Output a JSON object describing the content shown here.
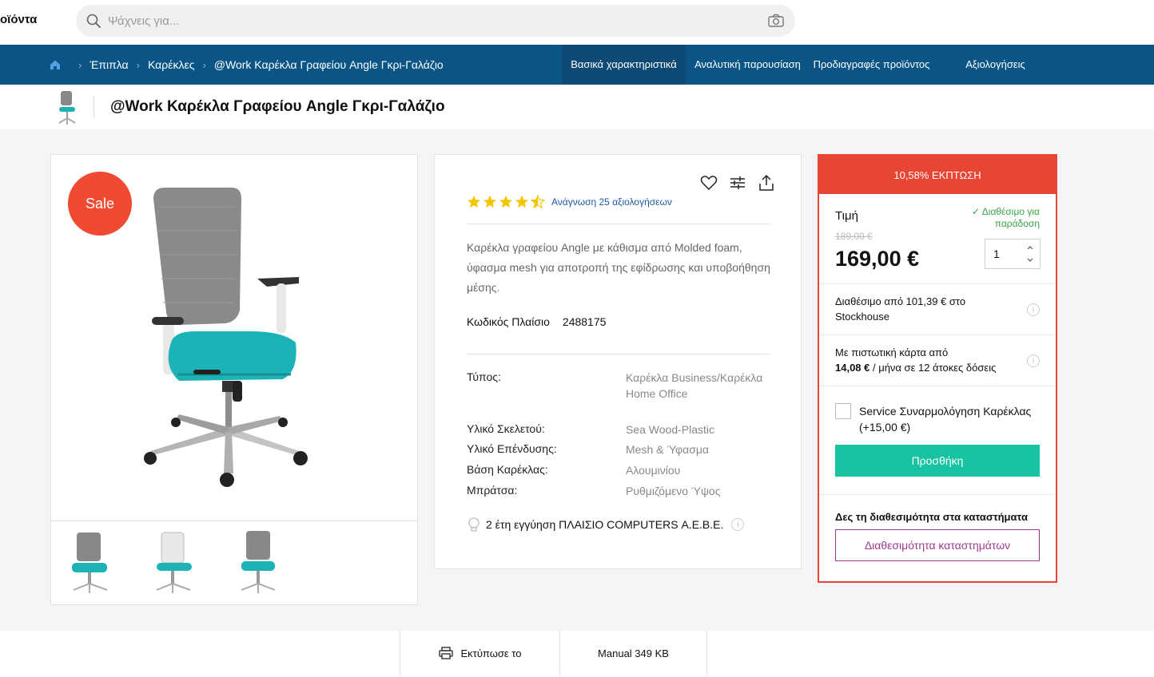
{
  "header": {
    "brand_fragment": "οϊόντα",
    "search_placeholder": "Ψάχνεις για...",
    "search_icon": "search-icon",
    "camera_icon": "camera-icon"
  },
  "breadcrumb": {
    "home_icon": "home-icon",
    "items": [
      "Έπιπλα",
      "Καρέκλες",
      "@Work Καρέκλα Γραφείου Angle Γκρι-Γαλάζιο"
    ]
  },
  "tabs": [
    {
      "label": "Βασικά χαρακτηριστικά",
      "active": true
    },
    {
      "label": "Αναλυτική παρουσίαση",
      "active": false
    },
    {
      "label": "Προδιαγραφές προϊόντος",
      "active": false
    },
    {
      "label": "Αξιολογήσεις",
      "active": false
    }
  ],
  "product": {
    "title": "@Work Καρέκλα Γραφείου Angle Γκρι-Γαλάζιο",
    "sale_badge": "Sale",
    "rating": 4.5,
    "reviews_link": "Ανάγνωση 25 αξιολογήσεων",
    "description": "Καρέκλα γραφείου Angle με κάθισμα από Molded foam, ύφασμα mesh για αποτροπή της εφίδρωσης και υποβοήθηση μέσης.",
    "code_label": "Κωδικός Πλαίσιο",
    "code_value": "2488175",
    "specs": [
      {
        "key": "Τύπος:",
        "value": "Καρέκλα Business/Καρέκλα Home Office"
      },
      {
        "key": "Υλικό Σκελετού:",
        "value": "Sea Wood-Plastic"
      },
      {
        "key": "Υλικό Επένδυσης:",
        "value": "Mesh & Ύφασμα"
      },
      {
        "key": "Βάση Καρέκλας:",
        "value": "Αλουμινίου"
      },
      {
        "key": "Μπράτσα:",
        "value": "Ρυθμιζόμενο Ύψος"
      }
    ],
    "warranty": "2 έτη εγγύηση ΠΛΑΙΣΙΟ COMPUTERS Α.Ε.Β.Ε."
  },
  "pricing": {
    "discount_banner": "10,58% ΕΚΠΤΩΣΗ",
    "price_label": "Τιμή",
    "availability": "✓ Διαθέσιμο για παράδοση",
    "old_price": "189,00 €",
    "price": "169,00 €",
    "quantity": "1",
    "stockhouse": "Διαθέσιμο από 101,39 € στο Stockhouse",
    "installments_line1": "Με πιστωτική κάρτα από",
    "installments_amount": "14,08 €",
    "installments_line2": " / μήνα σε 12 άτοκες δόσεις",
    "service_label": "Service Συναρμολόγηση Καρέκλας (+15,00 €)",
    "add_button": "Προσθήκη",
    "stores_heading": "Δες τη διαθεσιμότητα στα καταστήματα",
    "stores_button": "Διαθεσιμότητα καταστημάτων",
    "colors": {
      "discount": "#e84535",
      "add": "#17c3a0",
      "stores": "#9e3b8f",
      "available": "#3aa54b"
    }
  },
  "bottom": {
    "print_label": "Εκτύπωσε το",
    "manual_label": "Manual 349 KB"
  },
  "colors": {
    "nav": "#0a5585",
    "sale": "#f04a33",
    "star": "#f2c500",
    "link": "#1a5ba7"
  }
}
